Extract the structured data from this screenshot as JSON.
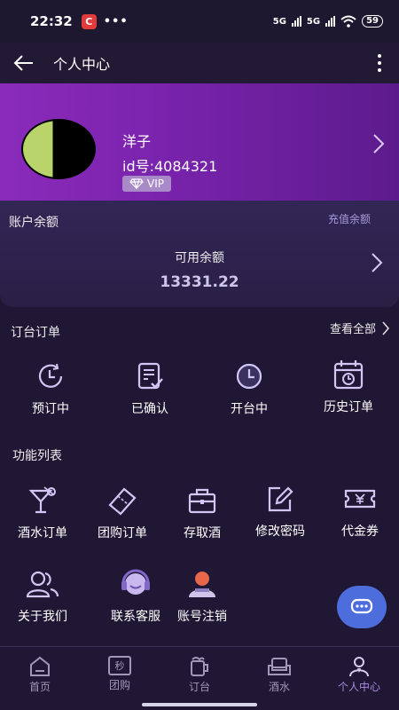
{
  "status_bar": {
    "time": "22:32",
    "app_badge": "C",
    "dots": "•••",
    "net1": "5G",
    "net2": "5G",
    "battery": "59"
  },
  "header": {
    "title": "个人中心"
  },
  "profile": {
    "name": "洋子",
    "id_text": "id号:4084321",
    "vip_label": "VIP"
  },
  "balance": {
    "section_title": "账户余额",
    "recharge_label": "充值余额",
    "available_label": "可用余额",
    "available_value": "13331.22"
  },
  "orders": {
    "section_title": "订台订单",
    "view_all": "查看全部",
    "items": [
      {
        "label": "预订中",
        "icon": "clock-refresh-icon"
      },
      {
        "label": "已确认",
        "icon": "document-check-icon"
      },
      {
        "label": "开台中",
        "icon": "clock-icon"
      },
      {
        "label": "历史订单",
        "icon": "calendar-history-icon"
      }
    ]
  },
  "features": {
    "section_title": "功能列表",
    "items": [
      {
        "label": "酒水订单",
        "icon": "cocktail-icon"
      },
      {
        "label": "团购订单",
        "icon": "ticket-icon"
      },
      {
        "label": "存取酒",
        "icon": "locker-icon"
      },
      {
        "label": "修改密码",
        "icon": "edit-icon"
      },
      {
        "label": "代金券",
        "icon": "voucher-icon"
      },
      {
        "label": "关于我们",
        "icon": "people-icon"
      },
      {
        "label": "联系客服",
        "icon": "headset-icon"
      },
      {
        "label": "账号注销",
        "icon": "user-cancel-icon"
      }
    ]
  },
  "tabbar": {
    "items": [
      {
        "label": "首页",
        "icon": "home-icon",
        "glyph": ""
      },
      {
        "label": "团购",
        "icon": "groupbuy-icon",
        "glyph": "秒"
      },
      {
        "label": "订台",
        "icon": "beer-icon",
        "glyph": ""
      },
      {
        "label": "酒水",
        "icon": "sofa-icon",
        "glyph": ""
      },
      {
        "label": "个人中心",
        "icon": "person-icon",
        "glyph": ""
      }
    ],
    "active_index": 4
  },
  "colors": {
    "background": "#1f1733",
    "profile_gradient_start": "#8a2bbb",
    "profile_gradient_end": "#5c1b8c",
    "icon_stroke": "#d3c6f4",
    "accent": "#a88ae0",
    "fab": "#4d6ddd"
  }
}
